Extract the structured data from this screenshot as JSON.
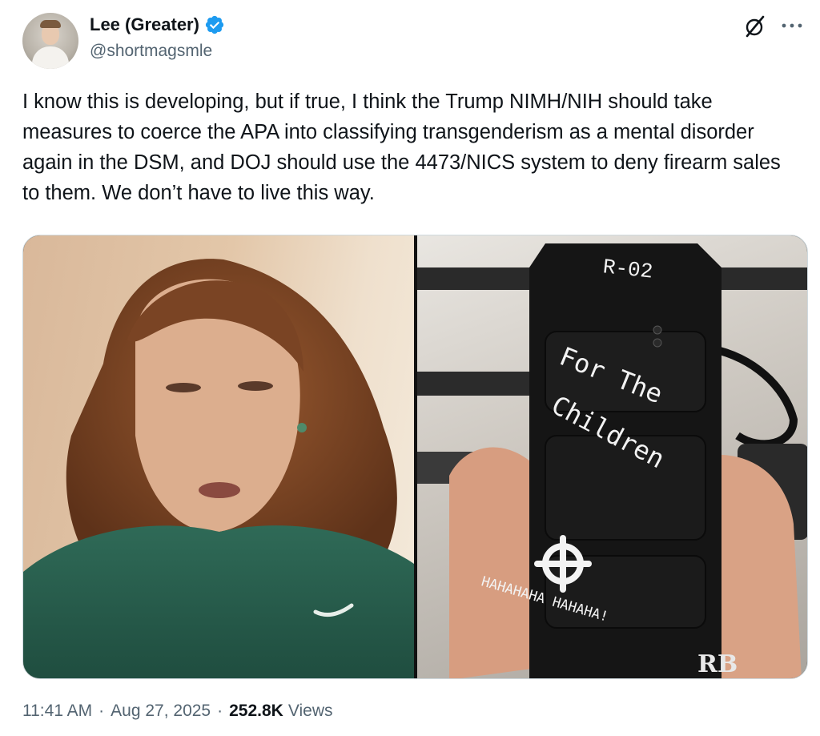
{
  "author": {
    "display_name": "Lee (Greater)",
    "handle": "@shortmagsmle",
    "verified": true,
    "avatar_icon": "profile-photo"
  },
  "header_actions": {
    "grok_icon": "grok-slash-circle-icon",
    "more_icon": "more-dots-icon"
  },
  "tweet": {
    "text": "I know this is developing, but if true, I think the Trump NIMH/NIH should take measures to coerce the APA into classifying transgenderism as a mental disorder again in the DSM, and DOJ should use the 4473/NICS system to deny firearm sales to them. We don’t have to live this way."
  },
  "media": {
    "images": [
      {
        "label": "Photo of a person in a green t-shirt"
      },
      {
        "label": "Photo of a rifle magazine held in a hand"
      }
    ],
    "magazine_text": {
      "top_label": "R-02",
      "line_1": "For The",
      "line_2": "Children",
      "bottom_text": "HAHAHAHA HAHAHA!",
      "watermark": "RB"
    }
  },
  "meta": {
    "time": "11:41 AM",
    "separator": "·",
    "date": "Aug 27, 2025",
    "views_count": "252.8K",
    "views_label": "Views"
  },
  "colors": {
    "text_primary": "#0f1419",
    "text_secondary": "#536471",
    "verified_blue": "#1d9bf0",
    "border": "#cfd9de"
  }
}
